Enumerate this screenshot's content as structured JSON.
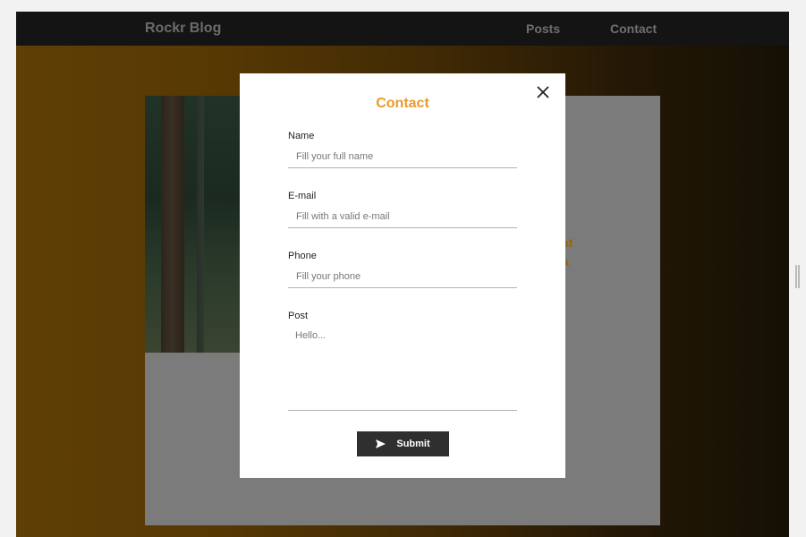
{
  "navbar": {
    "brand": "Rockr Blog",
    "links": [
      "Posts",
      "Contact"
    ]
  },
  "card": {
    "heading_lines": [
      "at",
      "a"
    ]
  },
  "modal": {
    "title": "Contact",
    "close_icon": "close-icon",
    "fields": [
      {
        "label": "Name",
        "placeholder": "Fill your full name",
        "value": ""
      },
      {
        "label": "E-mail",
        "placeholder": "Fill with a valid e-mail",
        "value": ""
      },
      {
        "label": "Phone",
        "placeholder": "Fill your phone",
        "value": ""
      },
      {
        "label": "Post",
        "placeholder": "Hello...",
        "value": ""
      }
    ],
    "submit": {
      "label": "Submit",
      "icon": "send-icon"
    }
  },
  "colors": {
    "accent": "#e89a2c",
    "navbar_bg": "#141414",
    "button_bg": "#2f2f2f"
  }
}
